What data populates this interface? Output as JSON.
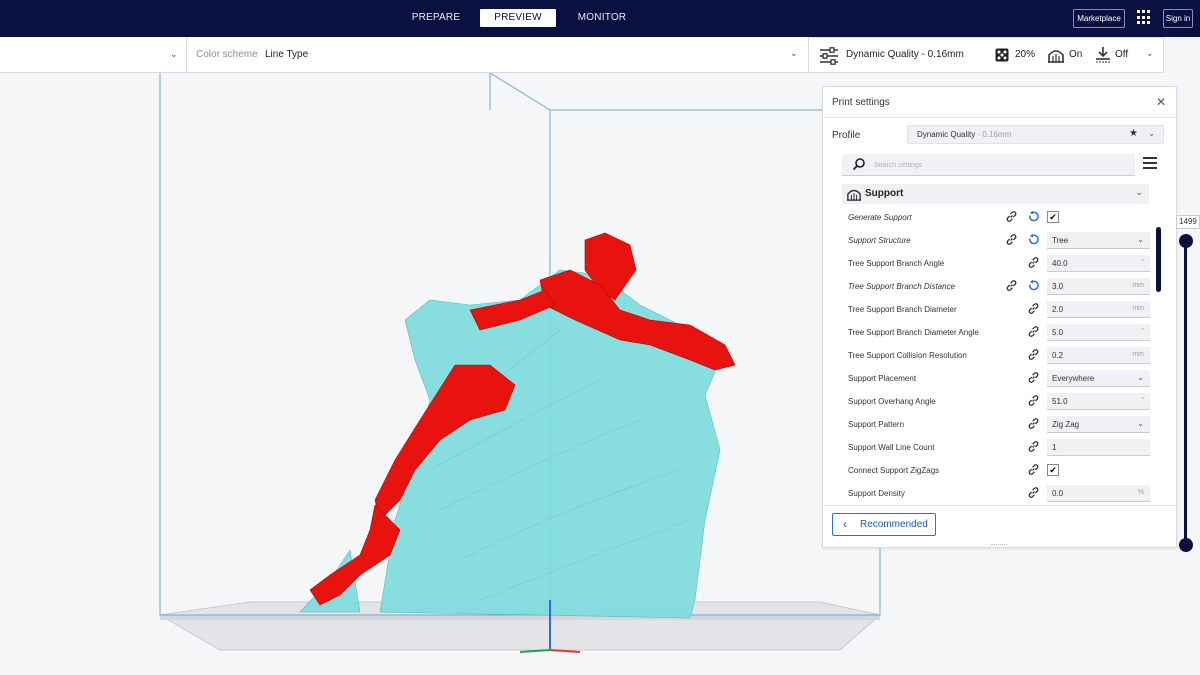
{
  "header": {
    "stages": [
      "PREPARE",
      "PREVIEW",
      "MONITOR"
    ],
    "active_stage": "PREVIEW",
    "marketplace_label": "Marketplace",
    "signin_label": "Sign in",
    "apps_icon": "apps-grid-icon"
  },
  "view_bar": {
    "color_scheme_label": "Color scheme",
    "color_scheme_value": "Line Type"
  },
  "print_bar": {
    "profile": "Dynamic Quality - 0.16mm",
    "infill": "20%",
    "support": "On",
    "adhesion": "Off",
    "icons": [
      "settings-sliders-icon",
      "infill-icon",
      "support-icon",
      "adhesion-icon"
    ]
  },
  "print_settings": {
    "title": "Print settings",
    "profile_label": "Profile",
    "profile_value": "Dynamic Quality",
    "profile_suffix": " - 0.16mm",
    "search_placeholder": "Search settings",
    "category": "Support",
    "settings": [
      {
        "label": "Generate Support",
        "italic": true,
        "reset": true,
        "type": "checkbox",
        "value": "✔"
      },
      {
        "label": "Support Structure",
        "italic": true,
        "reset": true,
        "type": "dropdown",
        "value": "Tree"
      },
      {
        "label": "Tree Support Branch Angle",
        "italic": false,
        "reset": false,
        "type": "number",
        "value": "40.0",
        "unit": "°"
      },
      {
        "label": "Tree Support Branch Distance",
        "italic": true,
        "reset": true,
        "type": "number",
        "value": "3.0",
        "unit": "mm"
      },
      {
        "label": "Tree Support Branch Diameter",
        "italic": false,
        "reset": false,
        "type": "number",
        "value": "2.0",
        "unit": "mm"
      },
      {
        "label": "Tree Support Branch Diameter Angle",
        "italic": false,
        "reset": false,
        "type": "number",
        "value": "5.0",
        "unit": "°"
      },
      {
        "label": "Tree Support Collision Resolution",
        "italic": false,
        "reset": false,
        "type": "number",
        "value": "0.2",
        "unit": "mm"
      },
      {
        "label": "Support Placement",
        "italic": false,
        "reset": false,
        "type": "dropdown",
        "value": "Everywhere"
      },
      {
        "label": "Support Overhang Angle",
        "italic": false,
        "reset": false,
        "type": "number",
        "value": "51.0",
        "unit": "°"
      },
      {
        "label": "Support Pattern",
        "italic": false,
        "reset": false,
        "type": "dropdown",
        "value": "Zig Zag"
      },
      {
        "label": "Support Wall Line Count",
        "italic": false,
        "reset": false,
        "type": "number",
        "value": "1",
        "unit": ""
      },
      {
        "label": "Connect Support ZigZags",
        "italic": false,
        "reset": false,
        "type": "checkbox",
        "value": "✔"
      },
      {
        "label": "Support Density",
        "italic": false,
        "reset": false,
        "type": "number",
        "value": "0.0",
        "unit": "%"
      }
    ],
    "recommended_label": "Recommended"
  },
  "layer_slider": {
    "top_layer": "1499",
    "position": 1.0
  },
  "colors": {
    "topbar": "#0a1140",
    "model": "#e8130f",
    "support": "#7fdcdc",
    "accent": "#2c6fd8",
    "build_volume": "#6aa9d8"
  }
}
